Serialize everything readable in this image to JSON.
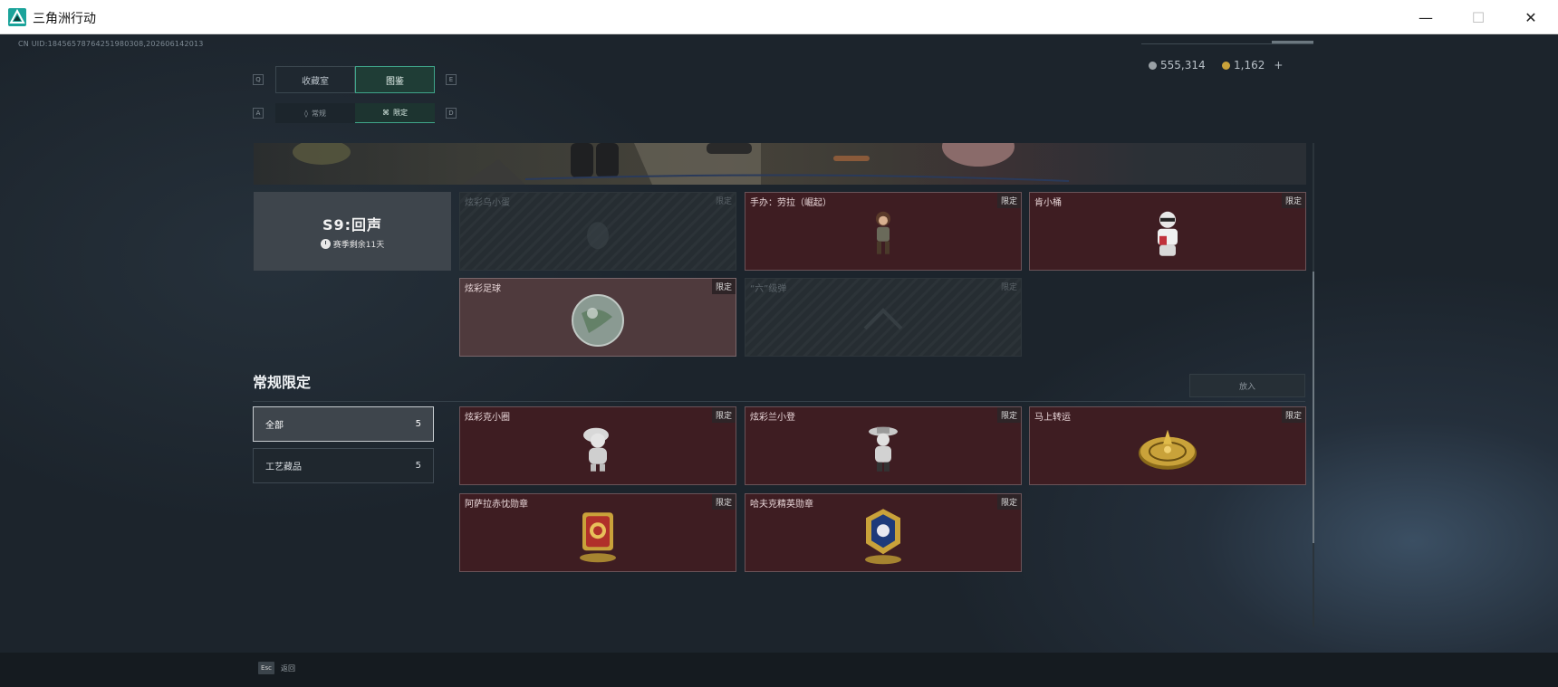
{
  "window": {
    "title": "三角洲行动",
    "minimize_glyph": "—",
    "maximize_glyph": "☐",
    "close_glyph": "✕"
  },
  "uid": "CN UID:184565787642519803​08,202606142013",
  "currency": {
    "silver": "555,314",
    "gold": "1,162",
    "add": "+"
  },
  "tabs": {
    "key_left": "Q",
    "key_right": "E",
    "items": [
      {
        "label": "收藏室"
      },
      {
        "label": "图鉴"
      }
    ]
  },
  "subtabs": {
    "key_left": "A",
    "key_right": "D",
    "items": [
      {
        "label": "常规"
      },
      {
        "label": "限定"
      }
    ]
  },
  "season": {
    "title": "S9:回声",
    "remaining": "赛季剩余11天"
  },
  "season_items": [
    {
      "name": "炫彩乌小蛋",
      "badge": "限定"
    },
    {
      "name": "手办：劳拉（崛起）",
      "badge": "限定"
    },
    {
      "name": "肯小桶",
      "badge": "限定"
    },
    {
      "name": "炫彩足球",
      "badge": "限定"
    },
    {
      "name": "“六”级弹",
      "badge": "限定"
    }
  ],
  "section": {
    "title": "常规限定",
    "put_button": "放入"
  },
  "filters": [
    {
      "label": "全部",
      "count": "5"
    },
    {
      "label": "工艺藏品",
      "count": "5"
    }
  ],
  "regular_items": [
    {
      "name": "炫彩克小圈",
      "badge": "限定"
    },
    {
      "name": "炫彩兰小登",
      "badge": "限定"
    },
    {
      "name": "马上转运",
      "badge": "限定"
    },
    {
      "name": "阿萨拉赤忱勋章",
      "badge": "限定"
    },
    {
      "name": "哈夫克精英勋章",
      "badge": "限定"
    }
  ],
  "footer": {
    "esc_key": "Esc",
    "back_label": "返回"
  },
  "colors": {
    "accent": "#3fa58a",
    "card_red": "#3e1d22",
    "gold": "#c9a23a"
  }
}
